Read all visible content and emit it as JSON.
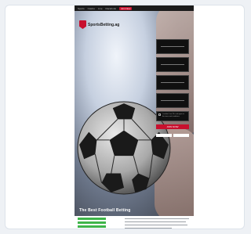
{
  "site": {
    "logo_text": "SportsBetting.ag",
    "nav": [
      "Sports",
      "Casino",
      "Live",
      "Racebook",
      "Join Now"
    ],
    "hero_caption": "The Best Football Betting",
    "form": {
      "placeholders": [
        "First Name",
        "Last Name",
        "Email",
        "Password"
      ],
      "terms": "I confirm I am 18+ and agree to the terms and conditions",
      "submit_label": "JOIN NOW"
    }
  }
}
